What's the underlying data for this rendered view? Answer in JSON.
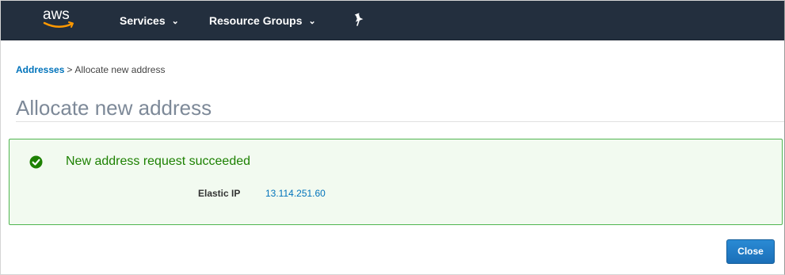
{
  "topnav": {
    "logo_text": "aws",
    "services_label": "Services",
    "resource_groups_label": "Resource Groups",
    "background_color": "#232f3e",
    "logo_smile_color": "#f90"
  },
  "breadcrumb": {
    "parent": "Addresses",
    "separator": ">",
    "current": "Allocate new address"
  },
  "page": {
    "title": "Allocate new address"
  },
  "alert": {
    "status": "success",
    "icon": "check-circle-icon",
    "title": "New address request succeeded",
    "field_label": "Elastic IP",
    "field_value": "13.114.251.60",
    "border_color": "#4fb54f",
    "text_color": "#1d8102"
  },
  "footer": {
    "close_label": "Close",
    "button_color": "#1b6fb8"
  }
}
